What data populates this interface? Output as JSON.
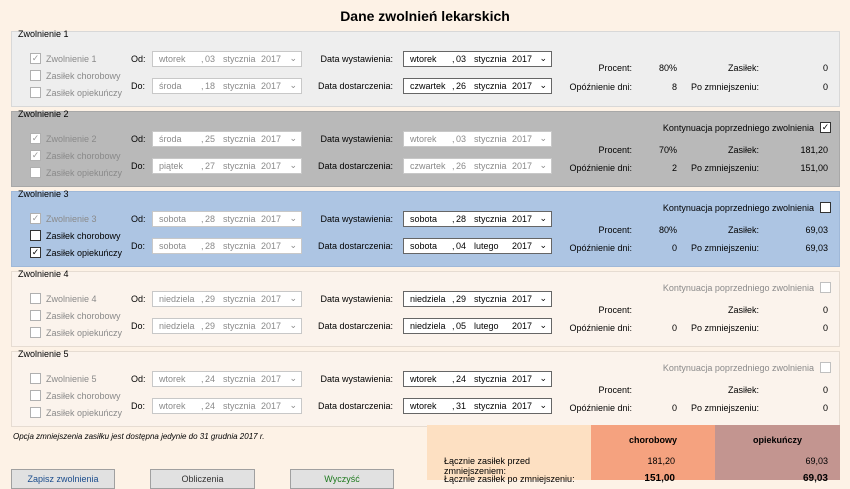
{
  "window_title": "Dane zwolnień lekarskich",
  "labels": {
    "od": "Od:",
    "do": "Do:",
    "data_wystawienia": "Data wystawienia:",
    "data_dostarczenia": "Data dostarczenia:",
    "procent": "Procent:",
    "opoznienie": "Opóźnienie dni:",
    "zasilek": "Zasiłek:",
    "po_zmniejszeniu": "Po zmniejszeniu:",
    "kontynuacja": "Kontynuacja poprzedniego zwolnienia"
  },
  "groups": [
    {
      "title": "Zwolnienie 1",
      "cb_main": {
        "label": "Zwolnienie 1",
        "checked": true,
        "enabled": false
      },
      "cb_chorobowy": {
        "label": "Zasiłek chorobowy",
        "checked": false,
        "enabled": false
      },
      "cb_opiekunczy": {
        "label": "Zasiłek opiekuńczy",
        "checked": false,
        "enabled": false
      },
      "od": {
        "day": "wtorek",
        "num": "03",
        "month": "stycznia",
        "year": "2017"
      },
      "do": {
        "day": "środa",
        "num": "18",
        "month": "stycznia",
        "year": "2017"
      },
      "wyst": {
        "day": "wtorek",
        "num": "03",
        "month": "stycznia",
        "year": "2017"
      },
      "dost": {
        "day": "czwartek",
        "num": "26",
        "month": "stycznia",
        "year": "2017"
      },
      "procent": "80%",
      "opoznienie": "8",
      "zasilek": "0",
      "po_zmniejszeniu": "0",
      "show_kontynuacja": false,
      "kontynuacja_checked": false
    },
    {
      "title": "Zwolnienie 2",
      "cb_main": {
        "label": "Zwolnienie 2",
        "checked": true,
        "enabled": false
      },
      "cb_chorobowy": {
        "label": "Zasiłek chorobowy",
        "checked": true,
        "enabled": false
      },
      "cb_opiekunczy": {
        "label": "Zasiłek opiekuńczy",
        "checked": false,
        "enabled": false
      },
      "od": {
        "day": "środa",
        "num": "25",
        "month": "stycznia",
        "year": "2017"
      },
      "do": {
        "day": "piątek",
        "num": "27",
        "month": "stycznia",
        "year": "2017"
      },
      "wyst": {
        "day": "wtorek",
        "num": "03",
        "month": "stycznia",
        "year": "2017"
      },
      "dost": {
        "day": "czwartek",
        "num": "26",
        "month": "stycznia",
        "year": "2017"
      },
      "procent": "70%",
      "opoznienie": "2",
      "zasilek": "181,20",
      "po_zmniejszeniu": "151,00",
      "show_kontynuacja": true,
      "kontynuacja_checked": true
    },
    {
      "title": "Zwolnienie 3",
      "cb_main": {
        "label": "Zwolnienie 3",
        "checked": true,
        "enabled": false
      },
      "cb_chorobowy": {
        "label": "Zasiłek chorobowy",
        "checked": false,
        "enabled": true
      },
      "cb_opiekunczy": {
        "label": "Zasiłek opiekuńczy",
        "checked": true,
        "enabled": true
      },
      "od": {
        "day": "sobota",
        "num": "28",
        "month": "stycznia",
        "year": "2017"
      },
      "do": {
        "day": "sobota",
        "num": "28",
        "month": "stycznia",
        "year": "2017"
      },
      "wyst": {
        "day": "sobota",
        "num": "28",
        "month": "stycznia",
        "year": "2017"
      },
      "dost": {
        "day": "sobota",
        "num": "04",
        "month": "lutego",
        "year": "2017"
      },
      "procent": "80%",
      "opoznienie": "0",
      "zasilek": "69,03",
      "po_zmniejszeniu": "69,03",
      "show_kontynuacja": true,
      "kontynuacja_checked": false
    },
    {
      "title": "Zwolnienie 4",
      "cb_main": {
        "label": "Zwolnienie 4",
        "checked": false,
        "enabled": false
      },
      "cb_chorobowy": {
        "label": "Zasiłek chorobowy",
        "checked": false,
        "enabled": false
      },
      "cb_opiekunczy": {
        "label": "Zasiłek opiekuńczy",
        "checked": false,
        "enabled": false
      },
      "od": {
        "day": "niedziela",
        "num": "29",
        "month": "stycznia",
        "year": "2017"
      },
      "do": {
        "day": "niedziela",
        "num": "29",
        "month": "stycznia",
        "year": "2017"
      },
      "wyst": {
        "day": "niedziela",
        "num": "29",
        "month": "stycznia",
        "year": "2017"
      },
      "dost": {
        "day": "niedziela",
        "num": "05",
        "month": "lutego",
        "year": "2017"
      },
      "procent": "",
      "opoznienie": "0",
      "zasilek": "0",
      "po_zmniejszeniu": "0",
      "show_kontynuacja": true,
      "kontynuacja_checked": false
    },
    {
      "title": "Zwolnienie 5",
      "cb_main": {
        "label": "Zwolnienie 5",
        "checked": false,
        "enabled": false
      },
      "cb_chorobowy": {
        "label": "Zasiłek chorobowy",
        "checked": false,
        "enabled": false
      },
      "cb_opiekunczy": {
        "label": "Zasiłek opiekuńczy",
        "checked": false,
        "enabled": false
      },
      "od": {
        "day": "wtorek",
        "num": "24",
        "month": "stycznia",
        "year": "2017"
      },
      "do": {
        "day": "wtorek",
        "num": "24",
        "month": "stycznia",
        "year": "2017"
      },
      "wyst": {
        "day": "wtorek",
        "num": "24",
        "month": "stycznia",
        "year": "2017"
      },
      "dost": {
        "day": "wtorek",
        "num": "31",
        "month": "stycznia",
        "year": "2017"
      },
      "procent": "",
      "opoznienie": "0",
      "zasilek": "0",
      "po_zmniejszeniu": "0",
      "show_kontynuacja": true,
      "kontynuacja_checked": false
    }
  ],
  "note": "Opcja zmniejszenia zasiłku jest dostępna jedynie do 31 grudnia 2017 r.",
  "summary": {
    "col_chorobowy": "chorobowy",
    "col_opiekunczy": "opiekuńczy",
    "row1_label": "Łącznie zasiłek przed zmniejszeniem:",
    "row1_chorobowy": "181,20",
    "row1_opiekunczy": "69,03",
    "row2_label": "Łącznie zasiłek po zmniejszeniu:",
    "row2_chorobowy": "151,00",
    "row2_opiekunczy": "69,03"
  },
  "buttons": [
    "Zapisz zwolnienia",
    "Obliczenia",
    "Wyczyść"
  ],
  "colors": {
    "background": "#fdf2e6",
    "group2": "#b9b9b9",
    "group3": "#adc5e3",
    "summary_left": "#fde0c2",
    "summary_chorobowy": "#f5a27f",
    "summary_opiekunczy": "#c39590"
  }
}
